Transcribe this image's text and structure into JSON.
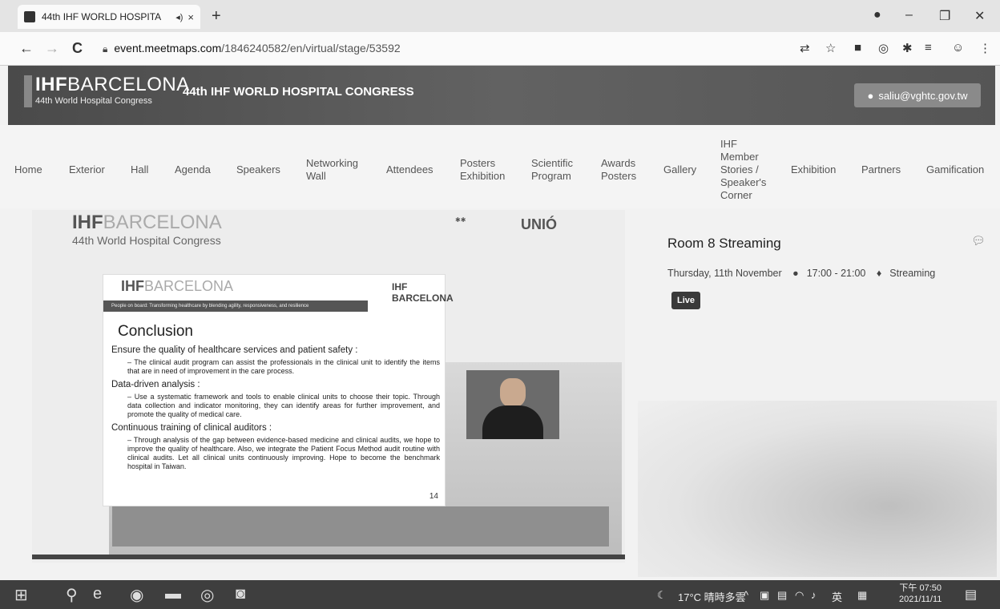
{
  "browser": {
    "tab_title": "44th IHF WORLD HOSPITA",
    "tab_audio_icon": "speaker-icon",
    "tab_close": "×",
    "new_tab": "+",
    "url_host": "event.meetmaps.com",
    "url_path": "/1846240582/en/virtual/stage/53592",
    "back": "←",
    "forward": "→",
    "reload": "C"
  },
  "site": {
    "logo_bold": "IHF",
    "logo_light": "BARCELONA",
    "logo_subtitle": "44th World Hospital Congress",
    "congress_title": "44th IHF WORLD HOSPITAL CONGRESS",
    "user_email": "saliu@vghtc.gov.tw"
  },
  "nav": [
    {
      "label": "Home"
    },
    {
      "label": "Exterior"
    },
    {
      "label": "Hall"
    },
    {
      "label": "Agenda"
    },
    {
      "label": "Speakers"
    },
    {
      "label": "Networking\nWall"
    },
    {
      "label": "Attendees"
    },
    {
      "label": "Posters\nExhibition"
    },
    {
      "label": "Scientific\nProgram"
    },
    {
      "label": "Awards\nPosters"
    },
    {
      "label": "Gallery"
    },
    {
      "label": "IHF\nMember\nStories /\nSpeaker's\nCorner"
    },
    {
      "label": "Exhibition"
    },
    {
      "label": "Partners"
    },
    {
      "label": "Gamification"
    }
  ],
  "stage": {
    "logo_bold": "IHF",
    "logo_light": "BARCELONA",
    "subtitle": "44th World Hospital Congress",
    "partner_logo": "UNIÓ"
  },
  "slide": {
    "logo_bold": "IHF",
    "logo_light": "BARCELONA",
    "banner": "People on board: Transforming healthcare by blending agility, responsiveness, and resilience",
    "ihf_badge": "IHF BARCELONA",
    "heading": "Conclusion",
    "sections": [
      {
        "title": "Ensure the quality of healthcare services and patient safety :",
        "text": "– The clinical audit program can assist the professionals in the clinical unit to identify the items that are in need of improvement in the care process."
      },
      {
        "title": "Data-driven analysis :",
        "text": "– Use a systematic framework and tools to enable clinical units to choose their topic. Through data collection and indicator monitoring, they can identify areas for further improvement, and promote the quality of medical care."
      },
      {
        "title": "Continuous training of clinical auditors :",
        "text": "– Through analysis of the gap between evidence-based medicine and clinical audits, we hope to improve the quality of healthcare. Also, we integrate the Patient Focus Method audit routine with clinical audits. Let all clinical units continuously improving. Hope to become the benchmark hospital in Taiwan."
      }
    ],
    "page_number": "14"
  },
  "room": {
    "title": "Room 8 Streaming",
    "date": "Thursday, 11th November",
    "time": "17:00 - 21:00",
    "location": "Streaming",
    "live_label": "Live"
  },
  "taskbar": {
    "weather": "17°C 晴時多雲",
    "ime": "英",
    "time": "下午 07:50",
    "date": "2021/11/11"
  },
  "colors": {
    "header_bg": "#555555",
    "live_bg": "#3a3a3a"
  }
}
